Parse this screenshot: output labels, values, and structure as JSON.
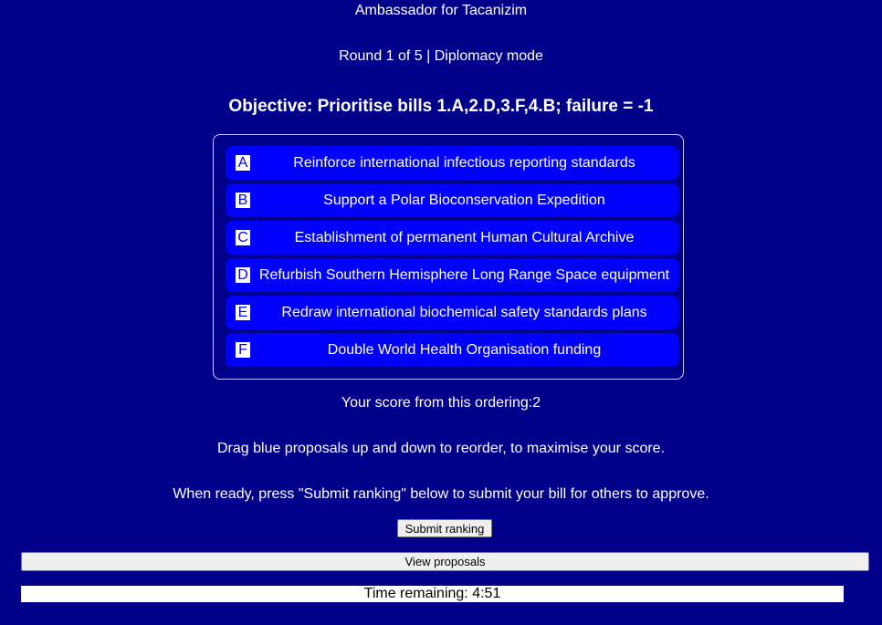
{
  "header": {
    "title": "Ambassador for Tacanizim",
    "round": "Round 1 of 5 | Diplomacy mode",
    "objective": "Objective: Prioritise bills 1.A,2.D,3.F,4.B; failure = -1"
  },
  "proposals": [
    {
      "letter": "A",
      "text": "Reinforce international infectious reporting standards"
    },
    {
      "letter": "B",
      "text": "Support a Polar Bioconservation Expedition"
    },
    {
      "letter": "C",
      "text": "Establishment of permanent Human Cultural Archive"
    },
    {
      "letter": "D",
      "text": "Refurbish Southern Hemisphere Long Range Space equipment"
    },
    {
      "letter": "E",
      "text": "Redraw international biochemical safety standards plans"
    },
    {
      "letter": "F",
      "text": "Double World Health Organisation funding"
    }
  ],
  "score_text": "Your score from this ordering:2",
  "instructions": {
    "drag": "Drag blue proposals up and down to reorder, to maximise your score.",
    "submit": "When ready, press \"Submit ranking\" below to submit your bill for others to approve."
  },
  "buttons": {
    "submit_label": "Submit ranking",
    "view_label": "View proposals"
  },
  "timer": {
    "text": "Time remaining: 4:51"
  },
  "colors": {
    "background": "#00008b",
    "proposal": "#0000ff",
    "text": "#ffffff"
  }
}
